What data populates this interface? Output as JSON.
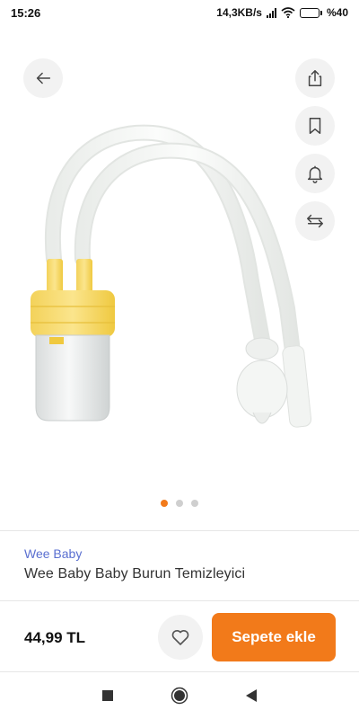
{
  "status_bar": {
    "time": "15:26",
    "network_speed": "14,3KB/s",
    "battery_level": "%40",
    "battery_fraction": 0.4
  },
  "actions": {
    "back_icon": "arrow-left-icon",
    "share_icon": "share-icon",
    "bookmark_icon": "bookmark-icon",
    "notify_icon": "bell-icon",
    "compare_icon": "arrows-swap-icon"
  },
  "gallery": {
    "image_count": 3,
    "active_index": 0,
    "active_color": "#f27a1a"
  },
  "product": {
    "brand": "Wee Baby",
    "name": "Wee Baby Baby Burun Temizleyici"
  },
  "purchase": {
    "price": "44,99 TL",
    "add_to_cart_label": "Sepete ekle",
    "accent_color": "#f27a1a",
    "favorite_icon": "heart-icon"
  },
  "system_nav": {
    "recents_icon": "square-icon",
    "home_icon": "circle-icon",
    "back_icon": "triangle-back-icon"
  }
}
